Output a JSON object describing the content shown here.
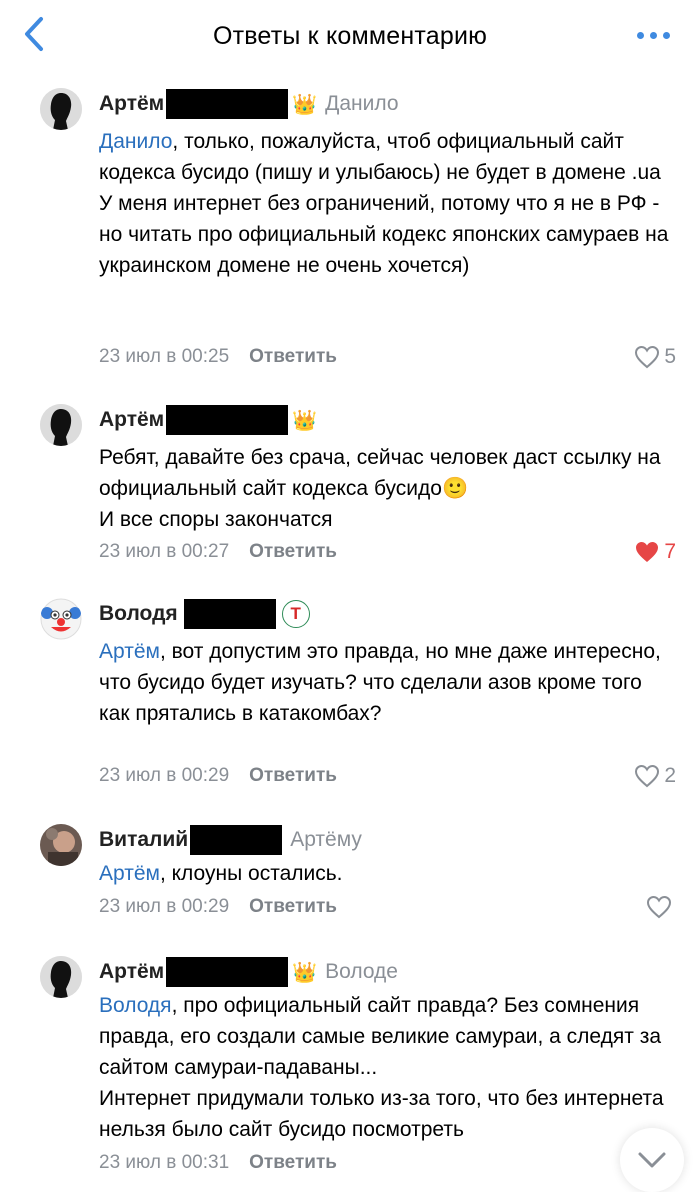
{
  "header": {
    "title": "Ответы к комментарию"
  },
  "comments": [
    {
      "author": "Артём",
      "badge": "👑",
      "reply_to": "Данило",
      "mention": "Данило",
      "text": ", только, пожалуйста, чтоб официальный сайт кодекса бусидо (пишу и улыбаюсь) не будет в домене .ua\nУ меня интернет без ограничений, потому что я не в РФ - но читать про официальный кодекс японских самураев на украинском домене не очень хочется)",
      "time": "23 июл в 00:25",
      "reply_label": "Ответить",
      "likes": "5",
      "liked": false
    },
    {
      "author": "Артём",
      "badge": "👑",
      "reply_to": "",
      "mention": "",
      "text": "Ребят, давайте без срача, сейчас человек даст ссылку на официальный сайт кодекса бусидо🙂\nИ все споры закончатся",
      "time": "23 июл в 00:27",
      "reply_label": "Ответить",
      "likes": "7",
      "liked": true
    },
    {
      "author": "Володя",
      "badge": "Т",
      "reply_to": "",
      "mention": "Артём",
      "text": ", вот допустим это правда, но мне даже интересно, что бусидо будет изучать? что сделали азов кроме того как прятались в катакомбах?",
      "time": "23 июл в 00:29",
      "reply_label": "Ответить",
      "likes": "2",
      "liked": false
    },
    {
      "author": "Виталий",
      "badge": "",
      "reply_to": "Артёму",
      "mention": "Артём",
      "text": ", клоуны остались.",
      "time": "23 июл в 00:29",
      "reply_label": "Ответить",
      "likes": "",
      "liked": false
    },
    {
      "author": "Артём",
      "badge": "👑",
      "reply_to": "Володе",
      "mention": "Володя",
      "text": ", про официальный сайт правда? Без сомнения правда, его создали самые великие самураи, а следят за сайтом самураи-падаваны...\nИнтернет придумали только из-за того, что без интернета нельзя было сайт бусидо посмотреть",
      "time": "23 июл в 00:31",
      "reply_label": "Ответить",
      "likes": "",
      "liked": false
    }
  ],
  "colors": {
    "accent": "#3f8ae0",
    "mention": "#2a6fbd",
    "liked": "#e64646",
    "muted": "#8a8f96"
  }
}
